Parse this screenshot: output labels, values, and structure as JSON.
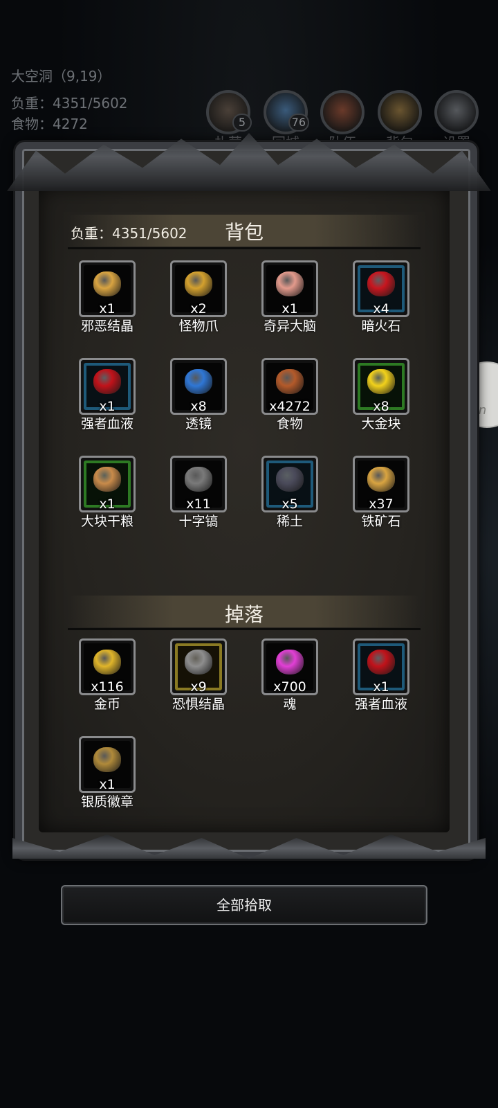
{
  "status": {
    "location": "大空洞（9,19）",
    "weight": "负重：4351/5602",
    "food": "食物：4272"
  },
  "topmenu": [
    {
      "label": "扎营",
      "icon": "campfire-icon",
      "badge": "5"
    },
    {
      "label": "回城",
      "icon": "portal-icon",
      "badge": "76"
    },
    {
      "label": "队伍",
      "icon": "team-icon",
      "badge": ""
    },
    {
      "label": "背包",
      "icon": "backpack-icon",
      "badge": ""
    },
    {
      "label": "设置",
      "icon": "gear-icon",
      "badge": ""
    }
  ],
  "side_bubble": {
    "text": "Ten"
  },
  "backpack": {
    "title": "背包",
    "weight": "负重：4351/5602",
    "items": [
      {
        "name": "邪恶结晶",
        "qty": "x1",
        "rarity": "normal",
        "icon": "evil-crystal-icon",
        "color": "#d9a441"
      },
      {
        "name": "怪物爪",
        "qty": "x2",
        "rarity": "normal",
        "icon": "monster-claw-icon",
        "color": "#d4a12e"
      },
      {
        "name": "奇异大脑",
        "qty": "x1",
        "rarity": "normal",
        "icon": "brain-icon",
        "color": "#e39a8c"
      },
      {
        "name": "暗火石",
        "qty": "x4",
        "rarity": "blue",
        "icon": "dark-firestone-icon",
        "color": "#c8161f"
      },
      {
        "name": "强者血液",
        "qty": "x1",
        "rarity": "blue",
        "icon": "blood-drop-icon",
        "color": "#c1121a"
      },
      {
        "name": "透镜",
        "qty": "x8",
        "rarity": "normal",
        "icon": "lens-icon",
        "color": "#2f77d6"
      },
      {
        "name": "食物",
        "qty": "x4272",
        "rarity": "normal",
        "icon": "drumstick-icon",
        "color": "#b45a2a"
      },
      {
        "name": "大金块",
        "qty": "x8",
        "rarity": "green",
        "icon": "gold-nugget-icon",
        "color": "#f2d11b"
      },
      {
        "name": "大块干粮",
        "qty": "x1",
        "rarity": "green",
        "icon": "ration-icon",
        "color": "#c98b4a"
      },
      {
        "name": "十字镐",
        "qty": "x11",
        "rarity": "normal",
        "icon": "pickaxe-icon",
        "color": "#7a7a7a"
      },
      {
        "name": "稀土",
        "qty": "x5",
        "rarity": "blue",
        "icon": "rare-earth-icon",
        "color": "#4a4a5a"
      },
      {
        "name": "铁矿石",
        "qty": "x37",
        "rarity": "normal",
        "icon": "iron-ore-icon",
        "color": "#d9a441"
      }
    ]
  },
  "drops": {
    "title": "掉落",
    "items": [
      {
        "name": "金币",
        "qty": "x116",
        "rarity": "normal",
        "icon": "gold-coins-icon",
        "color": "#e0b52a"
      },
      {
        "name": "恐惧结晶",
        "qty": "x9",
        "rarity": "gold",
        "icon": "fear-crystal-icon",
        "color": "#8e8e8e"
      },
      {
        "name": "魂",
        "qty": "x700",
        "rarity": "normal",
        "icon": "soul-icon",
        "color": "#e23fd6"
      },
      {
        "name": "强者血液",
        "qty": "x1",
        "rarity": "blue",
        "icon": "blood-drop-icon",
        "color": "#c1121a"
      },
      {
        "name": "银质徽章",
        "qty": "x1",
        "rarity": "normal",
        "icon": "silver-badge-icon",
        "color": "#b08a3a"
      }
    ]
  },
  "button": {
    "label": "全部拾取"
  }
}
